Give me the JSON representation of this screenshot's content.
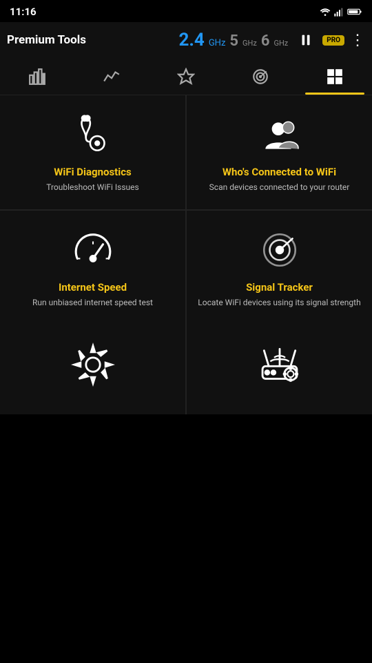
{
  "statusBar": {
    "time": "11:16"
  },
  "appBar": {
    "title": "Premium Tools",
    "freq24": "2.4",
    "freq24ghz": "GHz",
    "freq5": "5",
    "freq5ghz": "GHz",
    "freq6": "6",
    "freq6ghz": "GHz",
    "pauseLabel": "⏸",
    "proBadge": "PRO",
    "moreLabel": "⋮"
  },
  "tabs": [
    {
      "id": "tab-bar-chart",
      "label": "Bar Chart",
      "active": false
    },
    {
      "id": "tab-trend",
      "label": "Trend",
      "active": false
    },
    {
      "id": "tab-star",
      "label": "Star",
      "active": false
    },
    {
      "id": "tab-radar",
      "label": "Radar",
      "active": false
    },
    {
      "id": "tab-grid",
      "label": "Grid",
      "active": true
    }
  ],
  "tools": [
    {
      "id": "wifi-diagnostics",
      "title": "WiFi Diagnostics",
      "desc": "Troubleshoot WiFi Issues",
      "icon": "stethoscope"
    },
    {
      "id": "whos-connected",
      "title": "Who's Connected to WiFi",
      "desc": "Scan devices connected to your router",
      "icon": "people"
    },
    {
      "id": "internet-speed",
      "title": "Internet Speed",
      "desc": "Run unbiased internet speed test",
      "icon": "speedometer"
    },
    {
      "id": "signal-tracker",
      "title": "Signal Tracker",
      "desc": "Locate WiFi devices using its signal strength",
      "icon": "radar"
    },
    {
      "id": "settings",
      "title": "",
      "desc": "",
      "icon": "gear"
    },
    {
      "id": "router-settings",
      "title": "",
      "desc": "",
      "icon": "router-gear"
    }
  ]
}
